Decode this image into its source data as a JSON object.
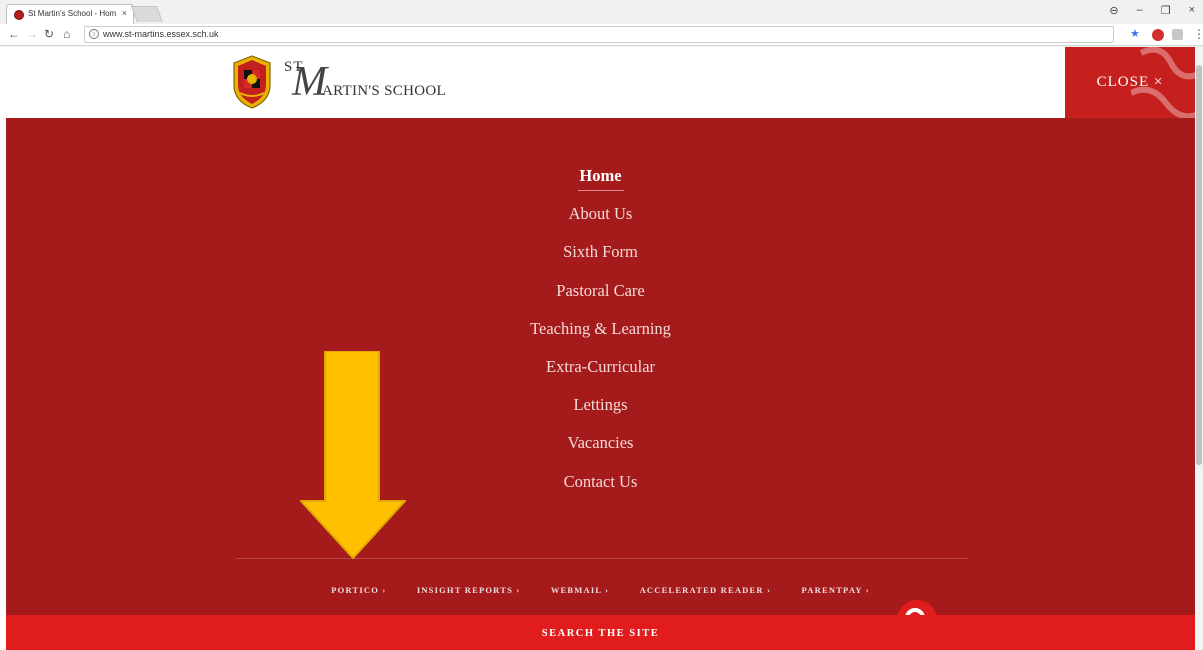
{
  "browser": {
    "tab_title": "St Martin's School - Hom",
    "tab_close": "×",
    "url": "www.st-martins.essex.sch.uk",
    "window_controls": [
      "⊖",
      "–",
      "❐",
      "×"
    ]
  },
  "header": {
    "logo_st": "ST",
    "logo_m": "M",
    "logo_rest": "ARTIN'S SCHOOL",
    "close_label": "CLOSE ×"
  },
  "nav": {
    "items": [
      {
        "label": "Home",
        "active": true
      },
      {
        "label": "About Us"
      },
      {
        "label": "Sixth Form"
      },
      {
        "label": "Pastoral Care"
      },
      {
        "label": "Teaching & Learning"
      },
      {
        "label": "Extra-Curricular"
      },
      {
        "label": "Lettings"
      },
      {
        "label": "Vacancies"
      },
      {
        "label": "Contact Us"
      }
    ]
  },
  "quick_links": [
    "PORTICO ›",
    "INSIGHT REPORTS ›",
    "WEBMAIL ›",
    "ACCELERATED READER ›",
    "PARENTPAY ›"
  ],
  "search": {
    "label": "SEARCH THE SITE"
  },
  "colors": {
    "menu_bg": "#a51b1b",
    "close_bg": "#c6201e",
    "search_bg": "#e11c1c",
    "annotation_arrow": "#ffc000"
  }
}
